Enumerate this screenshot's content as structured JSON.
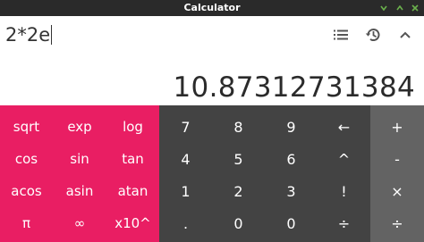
{
  "window": {
    "title": "Calculator"
  },
  "display": {
    "formula": "2*2e",
    "result": "10.87312731384"
  },
  "toolbar": {
    "history_list_icon": "list-icon",
    "history_icon": "history-icon",
    "collapse_icon": "chevron-up-icon"
  },
  "keypad": {
    "advanced": [
      [
        "sqrt",
        "exp",
        "log"
      ],
      [
        "cos",
        "sin",
        "tan"
      ],
      [
        "acos",
        "asin",
        "atan"
      ],
      [
        "π",
        "∞",
        "x10^"
      ]
    ],
    "numeric": [
      [
        "7",
        "8",
        "9",
        "←"
      ],
      [
        "4",
        "5",
        "6",
        "^"
      ],
      [
        "1",
        "2",
        "3",
        "!"
      ],
      [
        ".",
        "0",
        "0",
        "÷"
      ]
    ],
    "operators": [
      "+",
      "-",
      "×",
      "÷"
    ]
  },
  "colors": {
    "titlebar": "#2a2a2a",
    "advanced_panel": "#e91e63",
    "numeric_panel": "#434343",
    "operator_panel": "#636363"
  }
}
